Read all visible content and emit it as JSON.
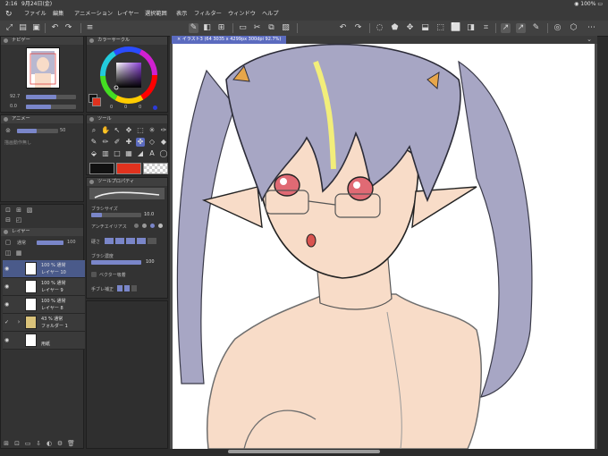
{
  "status": {
    "time": "2:16",
    "date": "9月24日(金)",
    "battery": "100%"
  },
  "menu": [
    "ファイル",
    "編集",
    "アニメーション",
    "レイヤー",
    "選択範囲",
    "表示",
    "フィルター",
    "ウィンドウ",
    "ヘルプ"
  ],
  "navigator": {
    "title": "ナビゲー",
    "zoom": "92.7",
    "angle": "0.0"
  },
  "color_panel": {
    "title": "カラーサークル",
    "h": "0",
    "s": "0",
    "v": "0"
  },
  "animation_panel": {
    "title": "アニメー",
    "label": "描画動作無し",
    "value": "50"
  },
  "tool_panel": {
    "title": "ツール"
  },
  "tool_property": {
    "title": "ツールプロパティ",
    "brush_size_label": "ブラシサイズ",
    "brush_size": "10.0",
    "antialias_label": "アンチエイリアス",
    "hardness_label": "硬さ",
    "density_label": "ブラシ濃度",
    "density": "100",
    "vector_label": "ベクター吸着",
    "hand_label": "手ブレ補正"
  },
  "layer_panel": {
    "title": "レイヤー",
    "blend": "通常",
    "opacity": "100"
  },
  "layers": [
    {
      "line1": "100 % 通常",
      "line2": "レイヤー 10",
      "selected": true
    },
    {
      "line1": "100 % 通常",
      "line2": "レイヤー 9",
      "selected": false
    },
    {
      "line1": "100 % 通常",
      "line2": "レイヤー 8",
      "selected": false
    },
    {
      "line1": "43 % 通常",
      "line2": "フォルダー 1",
      "selected": false
    },
    {
      "line1": "",
      "line2": "用紙",
      "selected": false
    }
  ],
  "document": {
    "tab": "イラスト3 (64 3035 x 4299px 300dpi 92.7%)"
  },
  "colors": {
    "accent": "#5b6bbf",
    "main_color": "#e0321e",
    "sub_color": "#111111",
    "hair": "#a7a6c4",
    "skin": "#f8dcc8",
    "eye": "#e06a74"
  }
}
